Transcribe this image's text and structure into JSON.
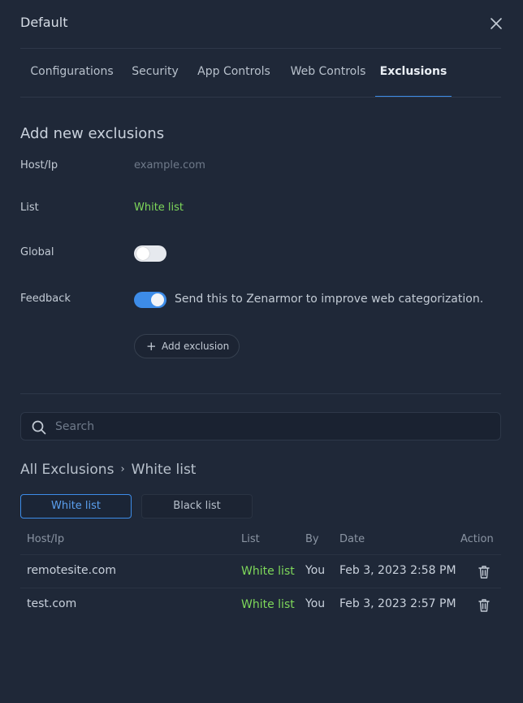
{
  "dialog": {
    "title": "Default"
  },
  "tabs": [
    {
      "label": "Configurations"
    },
    {
      "label": "Security"
    },
    {
      "label": "App Controls"
    },
    {
      "label": "Web Controls"
    },
    {
      "label": "Exclusions",
      "active": true
    }
  ],
  "form": {
    "title": "Add new exclusions",
    "host_label": "Host/Ip",
    "host_placeholder": "example.com",
    "list_label": "List",
    "list_value": "White list",
    "global_label": "Global",
    "global_on": false,
    "feedback_label": "Feedback",
    "feedback_on": true,
    "feedback_text": "Send this to Zenarmor to improve web categorization.",
    "add_button": "Add exclusion"
  },
  "search": {
    "placeholder": "Search"
  },
  "breadcrumb": {
    "root": "All Exclusions",
    "separator": "›",
    "current": "White list"
  },
  "filters": [
    {
      "label": "White list",
      "active": true
    },
    {
      "label": "Black list",
      "active": false
    }
  ],
  "table": {
    "headers": {
      "host": "Host/Ip",
      "list": "List",
      "by": "By",
      "date": "Date",
      "action": "Action"
    },
    "rows": [
      {
        "host": "remotesite.com",
        "list": "White list",
        "by": "You",
        "date": "Feb 3, 2023 2:58 PM"
      },
      {
        "host": "test.com",
        "list": "White list",
        "by": "You",
        "date": "Feb 3, 2023 2:57 PM"
      }
    ]
  },
  "colors": {
    "accent": "#3d8ce8",
    "green": "#7ed85a",
    "background": "#1f2838"
  },
  "icons": {
    "close": "close-icon",
    "search": "search-icon",
    "plus": "plus-icon",
    "delete": "trash-icon"
  }
}
